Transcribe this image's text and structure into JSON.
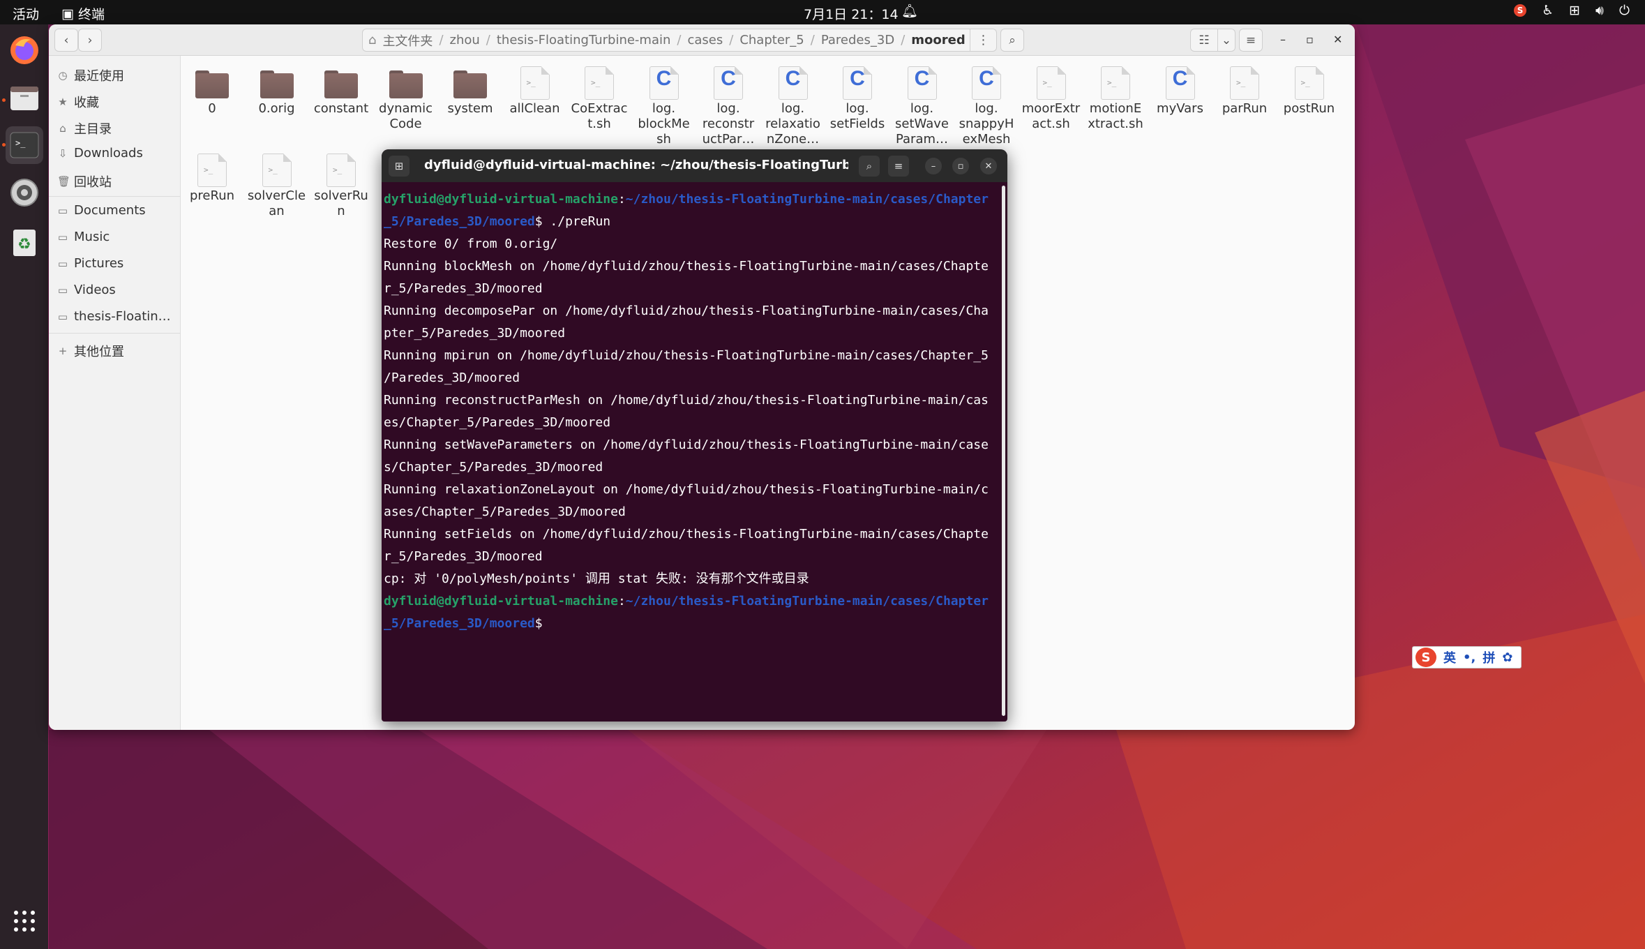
{
  "topbar": {
    "activities": "活动",
    "app_name": "终端",
    "clock": "7月1日 21：14"
  },
  "file_manager": {
    "path": [
      "主文件夹",
      "zhou",
      "thesis-FloatingTurbine-main",
      "cases",
      "Chapter_5",
      "Paredes_3D",
      "moored"
    ],
    "sidebar": {
      "recent": "最近使用",
      "starred": "收藏",
      "home": "主目录",
      "downloads": "Downloads",
      "trash": "回收站",
      "documents": "Documents",
      "music": "Music",
      "pictures": "Pictures",
      "videos": "Videos",
      "thesis": "thesis-Floatin…",
      "other": "其他位置"
    },
    "files": [
      {
        "name": "0",
        "type": "folder"
      },
      {
        "name": "0.orig",
        "type": "folder"
      },
      {
        "name": "constant",
        "type": "folder"
      },
      {
        "name": "dynamic\nCode",
        "type": "folder"
      },
      {
        "name": "system",
        "type": "folder"
      },
      {
        "name": "allClean",
        "type": "script"
      },
      {
        "name": "CoExtrac\nt.sh",
        "type": "script"
      },
      {
        "name": "log.\nblockMe\nsh",
        "type": "c"
      },
      {
        "name": "log.\nreconstr\nuctPar…",
        "type": "c"
      },
      {
        "name": "log.\nrelaxatio\nnZone…",
        "type": "c"
      },
      {
        "name": "log.\nsetFields",
        "type": "c"
      },
      {
        "name": "log.\nsetWave\nParam…",
        "type": "c"
      },
      {
        "name": "log.\nsnappyH\nexMesh",
        "type": "c"
      },
      {
        "name": "moorExtr\nact.sh",
        "type": "script"
      },
      {
        "name": "motionE\nxtract.sh",
        "type": "script"
      },
      {
        "name": "myVars",
        "type": "c"
      },
      {
        "name": "parRun",
        "type": "script"
      },
      {
        "name": "postRun",
        "type": "script"
      },
      {
        "name": "preRun",
        "type": "script"
      },
      {
        "name": "solverCle\nan",
        "type": "script"
      },
      {
        "name": "solverRu\nn",
        "type": "script"
      }
    ]
  },
  "terminal": {
    "title": "dyfluid@dyfluid-virtual-machine: ~/zhou/thesis-FloatingTurbine-m...",
    "prompt_user": "dyfluid@dyfluid-virtual-machine",
    "prompt_path_1": "~/zhou/thesis-FloatingTurbine-main/cases/Chapter",
    "prompt_path_2": "_5/Paredes_3D/moored",
    "command": "$ ./preRun",
    "output": [
      "Restore 0/ from 0.orig/",
      "Running blockMesh on /home/dyfluid/zhou/thesis-FloatingTurbine-main/cases/Chapte",
      "r_5/Paredes_3D/moored",
      "Running decomposePar on /home/dyfluid/zhou/thesis-FloatingTurbine-main/cases/Cha",
      "pter_5/Paredes_3D/moored",
      "Running mpirun on /home/dyfluid/zhou/thesis-FloatingTurbine-main/cases/Chapter_5",
      "/Paredes_3D/moored",
      "Running reconstructParMesh on /home/dyfluid/zhou/thesis-FloatingTurbine-main/cas",
      "es/Chapter_5/Paredes_3D/moored",
      "Running setWaveParameters on /home/dyfluid/zhou/thesis-FloatingTurbine-main/case",
      "s/Chapter_5/Paredes_3D/moored",
      "Running relaxationZoneLayout on /home/dyfluid/zhou/thesis-FloatingTurbine-main/c",
      "ases/Chapter_5/Paredes_3D/moored",
      "Running setFields on /home/dyfluid/zhou/thesis-FloatingTurbine-main/cases/Chapte",
      "r_5/Paredes_3D/moored",
      "cp: 对 '0/polyMesh/points' 调用 stat 失败: 没有那个文件或目录"
    ],
    "final_prompt_suffix": "$"
  },
  "ime": {
    "logo": "S",
    "lang": "英",
    "punct": "•,",
    "mode": "拼",
    "settings_glyph": "✿"
  }
}
